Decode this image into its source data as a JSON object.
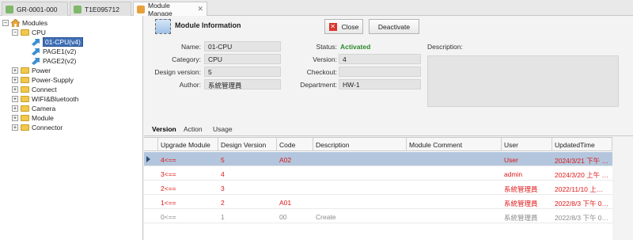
{
  "tabs": [
    {
      "label": "GR-0001-000",
      "color": "#7fb86a"
    },
    {
      "label": "T1E095712",
      "color": "#7fb86a"
    },
    {
      "label": "Module Manage",
      "color": "#e8a13a"
    }
  ],
  "tree": {
    "root": "Modules",
    "cpu": "CPU",
    "cpu_children": [
      "01-CPU(v4)",
      "PAGE1(v2)",
      "PAGE2(v2)"
    ],
    "categories": [
      "Power",
      "Power-Supply",
      "Connect",
      "WIFI&Bluetooth",
      "Camera",
      "Module",
      "Connector"
    ]
  },
  "header": {
    "title": "Module Information",
    "close_label": "Close",
    "deactivate_label": "Deactivate"
  },
  "form": {
    "name_label": "Name:",
    "name": "01-CPU",
    "category_label": "Category:",
    "category": "CPU",
    "design_version_label": "Design version:",
    "design_version": "5",
    "author_label": "Author:",
    "author": "系統管理員",
    "status_label": "Status:",
    "status": "Activated",
    "version_label": "Version:",
    "version": "4",
    "checkout_label": "Checkout:",
    "checkout": "",
    "department_label": "Department:",
    "department": "HW-1",
    "description_label": "Description:",
    "description": ""
  },
  "subtabs": [
    "Version",
    "Action",
    "Usage"
  ],
  "grid": {
    "columns": [
      "Upgrade Module",
      "Design Version",
      "Code",
      "Description",
      "Module Comment",
      "User",
      "UpdatedTime"
    ],
    "rows": [
      [
        "4<==",
        "5",
        "A02",
        "",
        "",
        "User",
        "2024/3/21 下午 …"
      ],
      [
        "3<==",
        "4",
        "",
        "",
        "",
        "admin",
        "2024/3/20 上午 …"
      ],
      [
        "2<==",
        "3",
        "",
        "",
        "",
        "系統管理員",
        "2022/11/10 上…"
      ],
      [
        "1<==",
        "2",
        "A01",
        "",
        "",
        "系統管理員",
        "2022/8/3 下午 0…"
      ],
      [
        "0<==",
        "1",
        "00",
        "Create",
        "",
        "系統管理員",
        "2022/8/3 下午 0…"
      ]
    ]
  },
  "colors": {
    "accent_red": "#e01818",
    "selection": "#3f6fb5",
    "status_green": "#2a8a2a"
  }
}
